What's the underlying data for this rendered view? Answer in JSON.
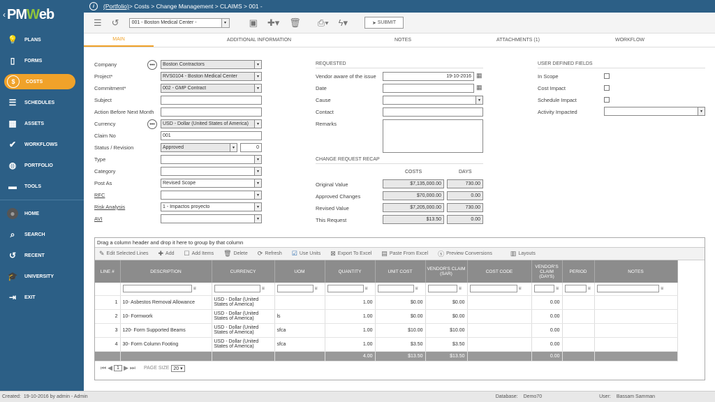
{
  "brand": {
    "logo": "PMWeb"
  },
  "nav": [
    {
      "label": "PLANS",
      "icon": "lightbulb-icon"
    },
    {
      "label": "FORMS",
      "icon": "document-icon"
    },
    {
      "label": "COSTS",
      "icon": "dollar-icon",
      "active": true
    },
    {
      "label": "SCHEDULES",
      "icon": "schedule-icon"
    },
    {
      "label": "ASSETS",
      "icon": "building-icon"
    },
    {
      "label": "WORKFLOWS",
      "icon": "check-icon"
    },
    {
      "label": "PORTFOLIO",
      "icon": "globe-icon"
    },
    {
      "label": "TOOLS",
      "icon": "toolbox-icon"
    },
    {
      "label": "HOME",
      "icon": "avatar"
    },
    {
      "label": "SEARCH",
      "icon": "search-icon"
    },
    {
      "label": "RECENT",
      "icon": "history-icon"
    },
    {
      "label": "UNIVERSITY",
      "icon": "graduation-cap-icon"
    },
    {
      "label": "EXIT",
      "icon": "exit-icon"
    }
  ],
  "breadcrumb": {
    "link": "(Portfolio)",
    "rest": " > Costs > Change Management > CLAIMS > 001 -"
  },
  "toolbar": {
    "record_select": "001 - Boston Medical Center -",
    "submit": "SUBMIT"
  },
  "tabs": [
    "MAIN",
    "ADDITIONAL INFORMATION",
    "NOTES",
    "ATTACHMENTS (1)",
    "WORKFLOW"
  ],
  "form": {
    "company": {
      "label": "Company",
      "value": "Boston Contractors"
    },
    "project": {
      "label": "Project*",
      "value": "RVS0104 - Boston Medical Center"
    },
    "commitment": {
      "label": "Commitment*",
      "value": "002 - GMP Contract"
    },
    "subject": {
      "label": "Subject",
      "value": ""
    },
    "action": {
      "label": "Action Before Next Month",
      "value": ""
    },
    "currency": {
      "label": "Currency",
      "value": "USD - Dollar (United States of America)"
    },
    "claim_no": {
      "label": "Claim No",
      "value": "001"
    },
    "status": {
      "label": "Status / Revision",
      "value": "Approved",
      "revision": "0"
    },
    "type": {
      "label": "Type",
      "value": ""
    },
    "category": {
      "label": "Category",
      "value": ""
    },
    "post_as": {
      "label": "Post As",
      "value": "Revised Scope"
    },
    "rfc": {
      "label": "RFC",
      "value": ""
    },
    "risk": {
      "label": "Risk Analysis",
      "value": "1 - Impactos proyecto"
    },
    "avi": {
      "label": "AVI",
      "value": ""
    }
  },
  "requested": {
    "title": "REQUESTED",
    "vendor_aware": {
      "label": "Vendor aware of the issue",
      "value": "19-10-2016"
    },
    "date": {
      "label": "Date",
      "value": ""
    },
    "cause": {
      "label": "Cause",
      "value": ""
    },
    "contact": {
      "label": "Contact",
      "value": ""
    },
    "remarks": {
      "label": "Remarks",
      "value": ""
    }
  },
  "recap": {
    "title": "CHANGE REQUEST RECAP",
    "col_costs": "COSTS",
    "col_days": "DAYS",
    "rows": [
      {
        "label": "Original Value",
        "costs": "$7,135,000.00",
        "days": "730.00"
      },
      {
        "label": "Approved Changes",
        "costs": "$70,000.00",
        "days": "0.00"
      },
      {
        "label": "Revised Value",
        "costs": "$7,205,000.00",
        "days": "730.00"
      },
      {
        "label": "This Request",
        "costs": "$13.50",
        "days": "0.00"
      }
    ]
  },
  "udf": {
    "title": "USER DEFINED FIELDS",
    "in_scope": "In Scope",
    "cost_impact": "Cost Impact",
    "schedule_impact": "Schedule Impact",
    "activity": "Activity Impacted"
  },
  "grid": {
    "drag_hint": "Drag a column header and drop it here to group by that column",
    "tools": [
      "Edit Selected Lines",
      "Add",
      "Add Items",
      "Delete",
      "Refresh",
      "Use Units",
      "Export To Excel",
      "Paste From Excel",
      "Preview Conversions",
      "Layouts"
    ],
    "headers": [
      "LINE #",
      "DESCRIPTION",
      "CURRENCY",
      "UOM",
      "QUANTITY",
      "UNIT COST",
      "VENDOR'S CLAIM (SAR)",
      "COST CODE",
      "VENDOR'S CLAIM (DAYS)",
      "PERIOD",
      "NOTES"
    ],
    "rows": [
      [
        "1",
        "10- Asbestos Removal Allowance",
        "USD - Dollar (United States of America)",
        "",
        "1.00",
        "$0.00",
        "$0.00",
        "",
        "0.00",
        "",
        ""
      ],
      [
        "2",
        "10- Formwork",
        "USD - Dollar (United States of America)",
        "ls",
        "1.00",
        "$0.00",
        "$0.00",
        "",
        "0.00",
        "",
        ""
      ],
      [
        "3",
        "120- Form Supported Beams",
        "USD - Dollar (United States of America)",
        "sfca",
        "1.00",
        "$10.00",
        "$10.00",
        "",
        "0.00",
        "",
        ""
      ],
      [
        "4",
        "30- Form Column Footing",
        "USD - Dollar (United States of America)",
        "sfca",
        "1.00",
        "$3.50",
        "$3.50",
        "",
        "0.00",
        "",
        ""
      ]
    ],
    "totals": {
      "quantity": "4.00",
      "unit_cost": "$13.50",
      "claim": "$13.50",
      "days": "0.00"
    },
    "pager": {
      "page": "1",
      "size_label": "PAGE SIZE",
      "size": "20"
    }
  },
  "footer": {
    "created_label": "Created:",
    "created": "19-10-2016 by admin - Admin",
    "db_label": "Database:",
    "db": "Demo70",
    "user_label": "User:",
    "user": "Bassam Samman"
  },
  "colors": {
    "sidebar": "#2c5f86",
    "accent": "#f0a22a",
    "brand_green": "#8fc33c"
  }
}
